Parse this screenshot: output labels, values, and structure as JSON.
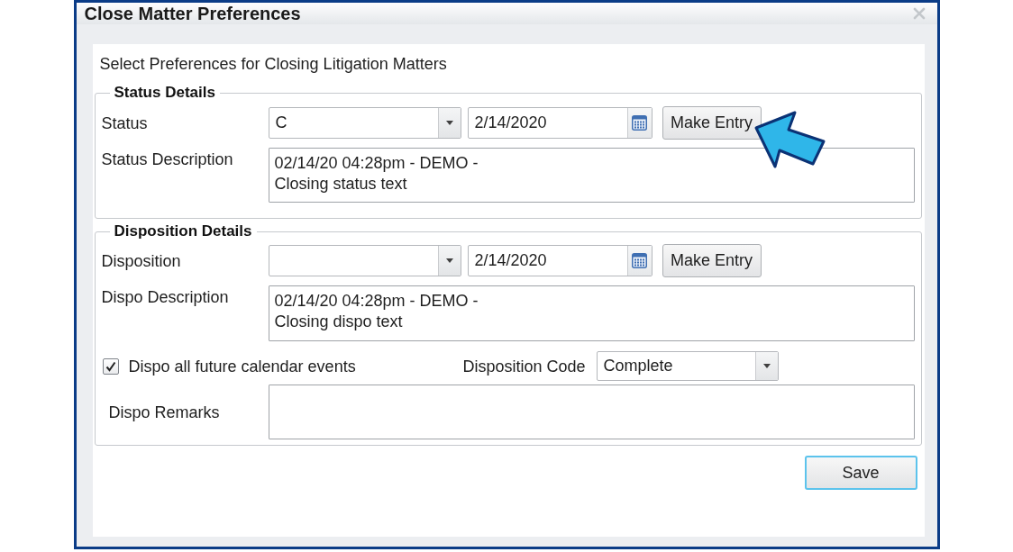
{
  "window": {
    "title": "Close Matter Preferences"
  },
  "intro": "Select Preferences for Closing Litigation Matters",
  "status_details": {
    "legend": "Status Details",
    "entry": {
      "label": "Status",
      "value": "C",
      "date": "2/14/2020",
      "button": "Make Entry",
      "pointed_at": true
    },
    "description": {
      "label": "Status Description",
      "value": "02/14/20 04:28pm - DEMO -\nClosing status text"
    }
  },
  "disposition_details": {
    "legend": "Disposition Details",
    "entry": {
      "label": "Disposition",
      "date": "2/14/2020",
      "button": "Make Entry"
    },
    "description": {
      "label": "Dispo Description",
      "value": "02/14/20 04:28pm - DEMO -\nClosing dispo text"
    },
    "future_events": {
      "label": "Dispo all future calendar events",
      "checked": true
    },
    "disposition_code": {
      "label": "Disposition Code",
      "value": "Complete"
    },
    "remarks": {
      "label": "Dispo Remarks"
    }
  },
  "save_button": {
    "label": "Save",
    "focused": true
  }
}
